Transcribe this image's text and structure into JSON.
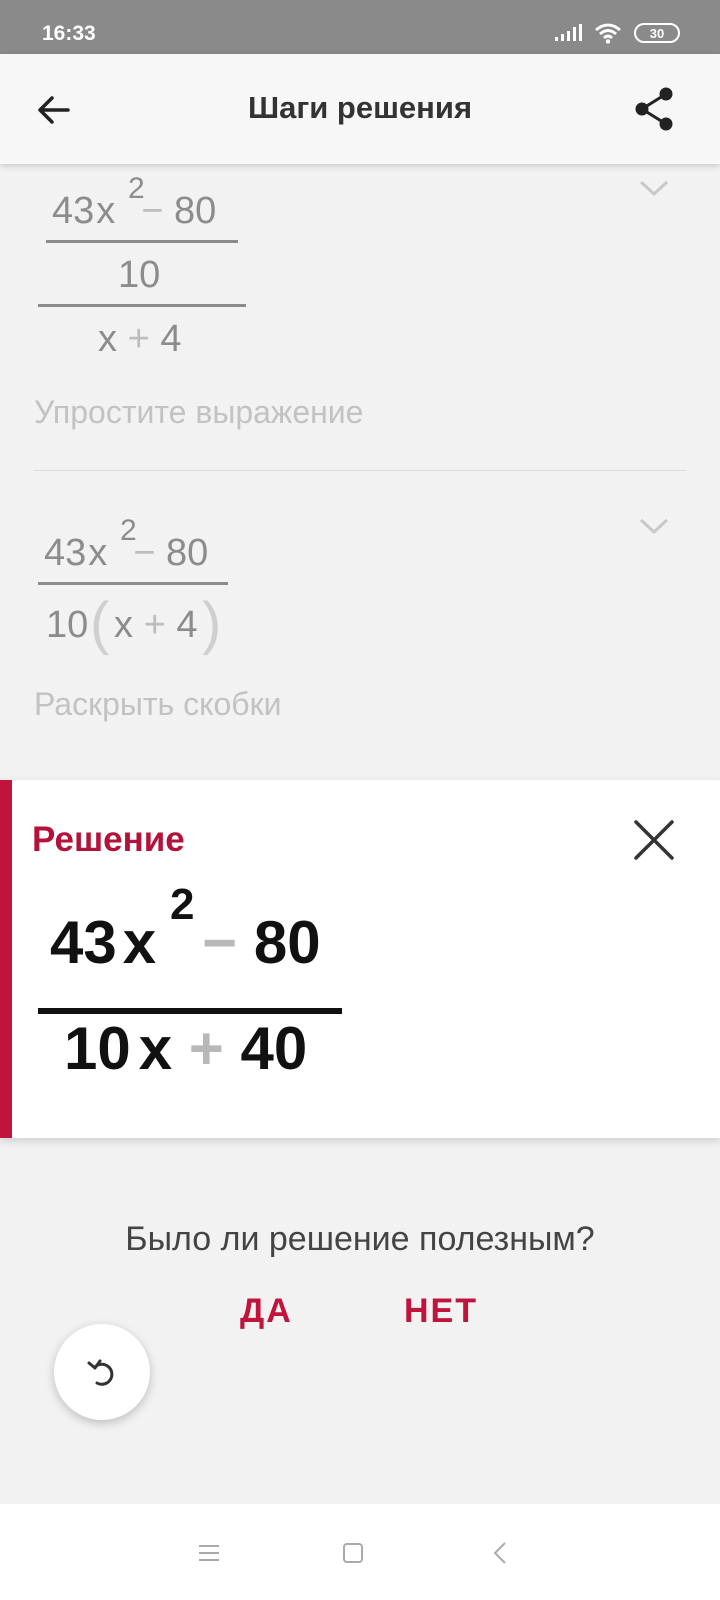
{
  "status_bar": {
    "time": "16:33",
    "battery": "30",
    "icons": [
      "signal-icon",
      "wifi-icon",
      "battery-icon"
    ]
  },
  "app_bar": {
    "title": "Шаги решения",
    "back_icon": "arrow-left-icon",
    "share_icon": "share-icon"
  },
  "steps": [
    {
      "expression": {
        "numerator": {
          "coef": "43",
          "var": "x",
          "exp": "2",
          "op": "−",
          "const": "80"
        },
        "inner_denominator": "10",
        "denominator": {
          "var": "x",
          "op": "+",
          "const": "4"
        }
      },
      "label": "Упростите выражение",
      "icon": "chevron-down-icon"
    },
    {
      "expression": {
        "numerator": {
          "coef": "43",
          "var": "x",
          "exp": "2",
          "op": "−",
          "const": "80"
        },
        "denominator": {
          "coef": "10",
          "open": "(",
          "var": "x",
          "op": "+",
          "const": "4",
          "close": ")"
        }
      },
      "label": "Раскрыть скобки",
      "icon": "chevron-down-icon"
    }
  ],
  "solution": {
    "title": "Решение",
    "close_icon": "close-icon",
    "numerator": {
      "coef": "43",
      "var": "x",
      "exp": "2",
      "op": "−",
      "const": "80"
    },
    "denominator": {
      "coef": "10",
      "var": "x",
      "op": "+",
      "const": "40"
    },
    "accent_color": "#c0143c"
  },
  "feedback": {
    "question": "Было ли решение полезным?",
    "yes_label": "ДА",
    "no_label": "НЕТ"
  },
  "fab": {
    "icon": "undo-icon"
  },
  "nav_bar": {
    "icons": [
      "menu-icon",
      "home-icon",
      "back-nav-icon"
    ]
  },
  "colors": {
    "accent": "#c0143c",
    "status_bar": "#8a8a8a",
    "background": "#f2f2f2"
  }
}
